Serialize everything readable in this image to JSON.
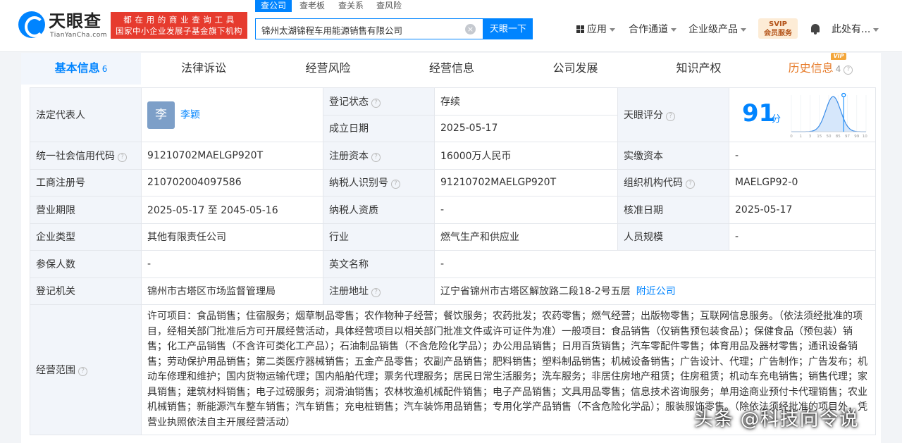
{
  "header": {
    "logo_name": "天眼查",
    "logo_sub": "TianYanCha.com",
    "slogan_line1": "都 在 用 的 商 业 查 询 工 具",
    "slogan_line2": "国家中小企业发展子基金旗下机构",
    "search_tabs": [
      "查公司",
      "查老板",
      "查关系",
      "查风险"
    ],
    "search_value": "锦州太湖锦程车用能源销售有限公司",
    "search_button": "天眼一下",
    "nav": {
      "apps": "应用",
      "channel": "合作通道",
      "enterprise": "企业级产品",
      "svip_top": "SVIP",
      "svip_bottom": "会员服务",
      "user": "此处有..."
    }
  },
  "tabs": [
    {
      "label": "基本信息",
      "count": "6"
    },
    {
      "label": "法律诉讼",
      "count": ""
    },
    {
      "label": "经营风险",
      "count": ""
    },
    {
      "label": "经营信息",
      "count": ""
    },
    {
      "label": "公司发展",
      "count": ""
    },
    {
      "label": "知识产权",
      "count": ""
    },
    {
      "label": "历史信息",
      "count": "4"
    }
  ],
  "vip_badge": "VIP",
  "info": {
    "legal_rep_label": "法定代表人",
    "legal_rep_avatar": "李",
    "legal_rep_name": "李颖",
    "reg_status_label": "登记状态",
    "reg_status": "存续",
    "est_date_label": "成立日期",
    "est_date": "2025-05-17",
    "score_label": "天眼评分",
    "score": "91",
    "score_unit": "分",
    "credit_code_label": "统一社会信用代码",
    "credit_code": "91210702MAELGP920T",
    "reg_capital_label": "注册资本",
    "reg_capital": "16000万人民币",
    "paid_capital_label": "实缴资本",
    "paid_capital": "-",
    "biz_reg_no_label": "工商注册号",
    "biz_reg_no": "210702004097586",
    "taxpayer_id_label": "纳税人识别号",
    "taxpayer_id": "91210702MAELGP920T",
    "org_code_label": "组织机构代码",
    "org_code": "MAELGP92-0",
    "term_label": "营业期限",
    "term": "2025-05-17 至 2045-05-16",
    "taxpayer_qual_label": "纳税人资质",
    "taxpayer_qual": "-",
    "approval_date_label": "核准日期",
    "approval_date": "2025-05-17",
    "company_type_label": "企业类型",
    "company_type": "其他有限责任公司",
    "industry_label": "行业",
    "industry": "燃气生产和供应业",
    "staff_size_label": "人员规模",
    "staff_size": "-",
    "insured_label": "参保人数",
    "insured": "-",
    "english_name_label": "英文名称",
    "english_name": "-",
    "reg_authority_label": "登记机关",
    "reg_authority": "锦州市古塔区市场监督管理局",
    "reg_address_label": "注册地址",
    "reg_address": "辽宁省锦州市古塔区解放路二段18-2号五层",
    "nearby_link": "附近公司",
    "scope_label": "经营范围",
    "scope": "许可项目：食品销售；住宿服务；烟草制品零售；农作物种子经营；餐饮服务；农药批发；农药零售；燃气经营；出版物零售；互联网信息服务。（依法须经批准的项目，经相关部门批准后方可开展经营活动，具体经营项目以相关部门批准文件或许可证件为准）一般项目：食品销售（仅销售预包装食品）；保健食品（预包装）销售；化工产品销售（不含许可类化工产品）；石油制品销售（不含危险化学品）；办公用品销售；日用百货销售；汽车零配件零售；体育用品及器材零售；通讯设备销售；劳动保护用品销售；第二类医疗器械销售；五金产品零售；农副产品销售；肥料销售；塑料制品销售；机械设备销售；广告设计、代理；广告制作；广告发布；机动车修理和维护；国内货物运输代理；国内船舶代理；票务代理服务；居民日常生活服务；洗车服务；非居住房地产租赁；住房租赁；机动车充电销售；销售代理；家具销售；建筑材料销售；电子过磅服务；润滑油销售；农林牧渔机械配件销售；电子产品销售；文具用品零售；信息技术咨询服务；单用途商业预付卡代理销售；农业机械销售；新能源汽车整车销售；汽车销售；充电桩销售；汽车装饰用品销售；专用化学产品销售（不含危险化学品）；服装服饰零售。（除依法须经批准的项目外，凭营业执照依法自主开展经营活动）"
  },
  "score_chart": {
    "ticks": [
      "0",
      "1",
      "3",
      "15",
      "50",
      "85",
      "97",
      "99",
      "100"
    ],
    "marker_index": 5.6
  },
  "watermark": "头条 @科技向令说",
  "colors": {
    "accent": "#0084ff",
    "status": "#00a35e",
    "history": "#e67a28",
    "slogan": "#e63b2e"
  }
}
